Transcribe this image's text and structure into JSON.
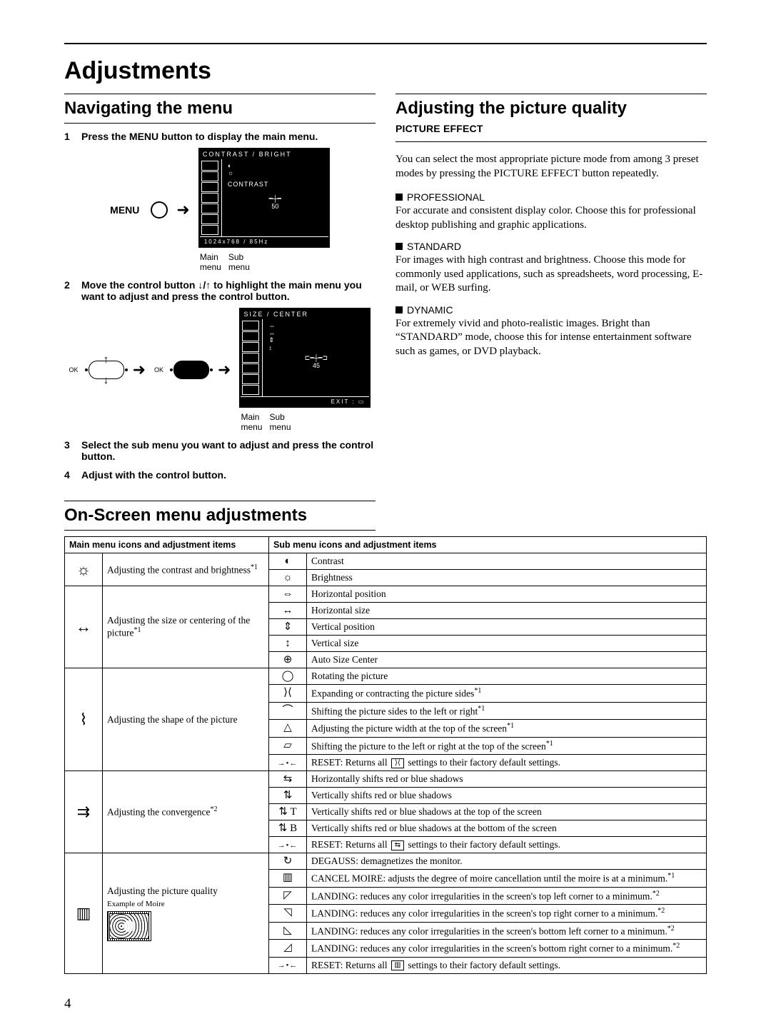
{
  "title": "Adjustments",
  "pageNumber": "4",
  "left": {
    "h2_nav": "Navigating the menu",
    "step1_num": "1",
    "step1_text": "Press the MENU button to display the main menu.",
    "menu_label": "MENU",
    "osd1_title": "CONTRAST / BRIGHT",
    "osd1_item": "CONTRAST",
    "osd1_value": "50",
    "osd1_status": "1024x768 /  85Hz",
    "caption_main": "Main\nmenu",
    "caption_sub": "Sub\nmenu",
    "step2_num": "2",
    "step2_text": "Move the control button ↓/↑ to highlight the main menu you want to adjust and press the control button.",
    "osd2_title": "SIZE / CENTER",
    "osd2_value": "45",
    "osd2_exit": "EXIT :",
    "step3_num": "3",
    "step3_text": "Select the sub menu you want to adjust and press the control button.",
    "step4_num": "4",
    "step4_text": "Adjust with the control button.",
    "h2_osm": "On-Screen menu adjustments"
  },
  "right": {
    "h2": "Adjusting the picture quality",
    "sub": "PICTURE EFFECT",
    "intro": "You can select the most appropriate picture mode from among 3 preset modes by pressing the PICTURE EFFECT button repeatedly.",
    "mode1_h": "PROFESSIONAL",
    "mode1_p": "For accurate and consistent display color. Choose this for professional desktop publishing and graphic applications.",
    "mode2_h": "STANDARD",
    "mode2_p": "For images with high contrast and brightness. Choose this mode for commonly used applications, such as spreadsheets, word processing, E-mail, or WEB surfing.",
    "mode3_h": "DYNAMIC",
    "mode3_p": "For extremely vivid and photo-realistic images. Bright than “STANDARD” mode, choose this for intense entertainment software such as games, or DVD playback."
  },
  "table": {
    "header_left": "Main menu icons and adjustment items",
    "header_right": "Sub menu icons and adjustment items",
    "groups": [
      {
        "icon": "☼",
        "label_html": "Adjusting the contrast and brightness*1",
        "rows": [
          {
            "icon": "◐",
            "text": "Contrast"
          },
          {
            "icon": "☼",
            "text": "Brightness"
          }
        ]
      },
      {
        "icon": "↔",
        "label_html": "Adjusting the size or centering of the picture*1",
        "rows": [
          {
            "icon": "⇔",
            "text": "Horizontal position"
          },
          {
            "icon": "↔",
            "text": "Horizontal size"
          },
          {
            "icon": "⇕",
            "text": "Vertical position"
          },
          {
            "icon": "↕",
            "text": "Vertical size"
          },
          {
            "icon": "⊕",
            "text": "Auto Size Center"
          }
        ]
      },
      {
        "icon": "⌇",
        "label_html": "Adjusting the shape of the picture",
        "rows": [
          {
            "icon": "◯",
            "text": "Rotating the picture"
          },
          {
            "icon": "⟩⟨",
            "text": "Expanding or contracting the picture sides*1"
          },
          {
            "icon": "⌒",
            "text": "Shifting the picture sides to the left or right*1"
          },
          {
            "icon": "△",
            "text": "Adjusting the picture width at the top of the screen*1"
          },
          {
            "icon": "▱",
            "text": "Shifting the picture to the left or right at the top of the screen*1"
          },
          {
            "icon": "→•←",
            "text": "RESET: Returns all  ⟩⟨  settings to their factory default settings."
          }
        ]
      },
      {
        "icon": "⇉",
        "label_html": "Adjusting the convergence*2",
        "rows": [
          {
            "icon": "⇆",
            "text": "Horizontally shifts red or blue shadows"
          },
          {
            "icon": "⇅",
            "text": "Vertically shifts red or blue shadows"
          },
          {
            "icon": "⇅ T",
            "text": "Vertically shifts red or blue shadows at the top of the screen"
          },
          {
            "icon": "⇅ B",
            "text": "Vertically shifts red or blue shadows at the bottom of the screen"
          },
          {
            "icon": "→•←",
            "text": "RESET: Returns all  ⇆  settings to their factory default settings."
          }
        ]
      },
      {
        "icon": "▥",
        "label_html": "Adjusting the picture quality",
        "moire_label": "Example of Moire",
        "rows": [
          {
            "icon": "↻",
            "text": "DEGAUSS: demagnetizes the monitor."
          },
          {
            "icon": "▥",
            "text": "CANCEL MOIRE: adjusts the degree of moire cancellation until the moire is at a minimum.*1"
          },
          {
            "icon": "◸",
            "text": "LANDING: reduces any color irregularities in the screen's top left corner to a minimum.*2"
          },
          {
            "icon": "◹",
            "text": "LANDING: reduces any color irregularities in the screen's top right corner to a minimum.*2"
          },
          {
            "icon": "◺",
            "text": "LANDING: reduces any color irregularities in the screen's bottom left corner to a minimum.*2"
          },
          {
            "icon": "◿",
            "text": "LANDING: reduces any color irregularities in the screen's bottom right corner to a minimum.*2"
          },
          {
            "icon": "→•←",
            "text": "RESET: Returns all  ▥  settings to their factory default settings."
          }
        ]
      }
    ]
  }
}
